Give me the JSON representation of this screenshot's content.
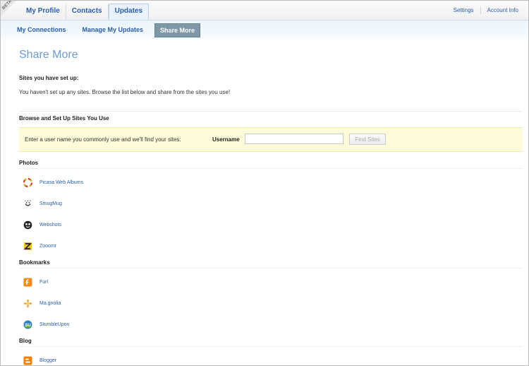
{
  "top": {
    "beta": "BETA",
    "tabs": [
      {
        "label": "My Profile"
      },
      {
        "label": "Contacts"
      },
      {
        "label": "Updates",
        "active": true
      }
    ],
    "links": [
      "Settings",
      "Account Info"
    ]
  },
  "subnav": {
    "items": [
      {
        "label": "My Connections"
      },
      {
        "label": "Manage My Updates"
      },
      {
        "label": "Share More",
        "active": true
      }
    ]
  },
  "page": {
    "title": "Share More",
    "setup_heading": "Sites you have set up:",
    "setup_text": "You haven't set up any sites. Browse the list below and share from the sites you use!",
    "browse_heading": "Browse and Set Up Sites You Use"
  },
  "find": {
    "prompt": "Enter a user name you commonly use and we'll find your sites:",
    "username_label": "Username",
    "username_value": "",
    "button_label": "Find Sites"
  },
  "sections": [
    {
      "title": "Photos",
      "sites": [
        {
          "label": "Picasa Web Albums",
          "icon": "picasa-icon"
        },
        {
          "label": "SmugMug",
          "icon": "smugmug-icon"
        },
        {
          "label": "Webshots",
          "icon": "webshots-icon"
        },
        {
          "label": "Zooomr",
          "icon": "zooomr-icon"
        }
      ]
    },
    {
      "title": "Bookmarks",
      "sites": [
        {
          "label": "Furl",
          "icon": "furl-icon"
        },
        {
          "label": "Ma.gnolia",
          "icon": "magnolia-icon"
        },
        {
          "label": "StumbleUpon",
          "icon": "stumbleupon-icon"
        }
      ]
    },
    {
      "title": "Blog",
      "sites": [
        {
          "label": "Blogger",
          "icon": "blogger-icon"
        }
      ]
    }
  ],
  "colors": {
    "link": "#2a5db0",
    "title": "#6b9ad3",
    "find_box_bg": "#fdfbd9",
    "active_subnav": "#7e98a7"
  }
}
